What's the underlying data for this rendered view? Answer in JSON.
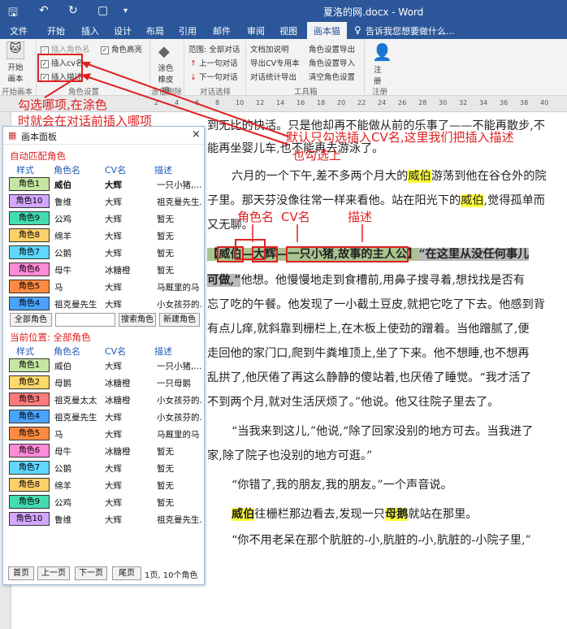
{
  "titlebar": {
    "title": "夏洛的网.docx - Word",
    "save_icon": "save-icon",
    "undo_icon": "undo-icon",
    "redo_icon": "redo-icon"
  },
  "tabs": [
    "文件",
    "开始",
    "插入",
    "设计",
    "布局",
    "引用",
    "邮件",
    "审阅",
    "视图",
    "画本猫"
  ],
  "tell_me": "告诉我您想要做什么...",
  "ribbon": {
    "start_label": "开始画本",
    "start_group": "开始画本",
    "cb_insert_role": "插入角色名",
    "cb_insert_cv": "插入cv名",
    "cb_insert_desc": "插入描述",
    "cb_highlight": "角色高亮",
    "group_roles": "角色设置",
    "eraser": "涂色橡皮擦",
    "group_erase": "涂色删除",
    "scope": "范围: 全部对话",
    "prev": "上一句对话",
    "next": "下一句对话",
    "group_dialog": "对话选择",
    "tool1": "文档加说明",
    "tool2": "导出CV专用本",
    "tool3": "对话统计导出",
    "tool4": "角色设置导出",
    "tool5": "角色设置导入",
    "tool6": "清空角色设置",
    "group_tools": "工具箱",
    "register": "注册",
    "group_register": "注册"
  },
  "panel": {
    "title": "画本面板",
    "section_auto": "自动匹配角色",
    "headers": [
      "样式",
      "角色名",
      "CV名",
      "描述"
    ],
    "auto_rows": [
      {
        "badge": "角色1",
        "color": "#c5e7a3",
        "name": "威伯",
        "cv": "大辉",
        "desc": "一只小猪,..."
      },
      {
        "badge": "角色10",
        "color": "#d3a6ff",
        "name": "鲁维",
        "cv": "大辉",
        "desc": "祖克曼先生..."
      },
      {
        "badge": "角色9",
        "color": "#43dcb0",
        "name": "公鸡",
        "cv": "大辉",
        "desc": "暂无"
      },
      {
        "badge": "角色8",
        "color": "#ffd06a",
        "name": "绵羊",
        "cv": "大辉",
        "desc": "暂无"
      },
      {
        "badge": "角色7",
        "color": "#5fd7ff",
        "name": "公鹅",
        "cv": "大辉",
        "desc": "暂无"
      },
      {
        "badge": "角色6",
        "color": "#ff8ad8",
        "name": "母牛",
        "cv": "冰糖橙",
        "desc": "暂无"
      },
      {
        "badge": "角色5",
        "color": "#ff8a40",
        "name": "马",
        "cv": "大辉",
        "desc": "马厩里的马"
      },
      {
        "badge": "角色4",
        "color": "#4aa3ff",
        "name": "祖克曼先生",
        "cv": "大辉",
        "desc": "小女孩芬的..."
      }
    ],
    "btn_all": "全部角色",
    "btn_search": "搜索角色",
    "btn_new": "新建角色",
    "section_current": "当前位置: 全部角色",
    "all_rows": [
      {
        "badge": "角色1",
        "color": "#c5e7a3",
        "name": "威伯",
        "cv": "大辉",
        "desc": "一只小猪,..."
      },
      {
        "badge": "角色2",
        "color": "#ffd96a",
        "name": "母鹅",
        "cv": "冰糖橙",
        "desc": "一只母鹅"
      },
      {
        "badge": "角色3",
        "color": "#ff7b7b",
        "name": "祖克曼太太",
        "cv": "冰糖橙",
        "desc": "小女孩芬的..."
      },
      {
        "badge": "角色4",
        "color": "#4aa3ff",
        "name": "祖克曼先生",
        "cv": "大辉",
        "desc": "小女孩芬的..."
      },
      {
        "badge": "角色5",
        "color": "#ff8a40",
        "name": "马",
        "cv": "大辉",
        "desc": "马厩里的马"
      },
      {
        "badge": "角色6",
        "color": "#ff8ad8",
        "name": "母牛",
        "cv": "冰糖橙",
        "desc": "暂无"
      },
      {
        "badge": "角色7",
        "color": "#5fd7ff",
        "name": "公鹅",
        "cv": "大辉",
        "desc": "暂无"
      },
      {
        "badge": "角色8",
        "color": "#ffd06a",
        "name": "绵羊",
        "cv": "大辉",
        "desc": "暂无"
      },
      {
        "badge": "角色9",
        "color": "#43dcb0",
        "name": "公鸡",
        "cv": "大辉",
        "desc": "暂无"
      },
      {
        "badge": "角色10",
        "color": "#d3a6ff",
        "name": "鲁维",
        "cv": "大辉",
        "desc": "祖克曼先生..."
      }
    ],
    "nav_first": "首页",
    "nav_prev": "上一页",
    "nav_next": "下一页",
    "nav_last": "尾页",
    "page_info": "1页, 10个角色"
  },
  "doc": {
    "p0": "到无比的快活。只是他却再不能做从前的乐事了——不能再散步,不",
    "p1": "能再坐婴儿车,也不能再去游泳了。",
    "p2a": "六月的一个下午,差不多两个月大的",
    "wilbur": "威伯",
    "p2b": "游荡到他在谷仓外的院",
    "p3a": "子里。那天芬没像往常一样来看他。站在阳光下的",
    "p3b": ",觉得孤单而",
    "p4": "又无聊。",
    "tag_open": "【",
    "tag_role": "威伯",
    "tag_cv": "大辉",
    "tag_desc": "一只小猪,故事的主人公",
    "tag_close": "】",
    "quote1": "“在这里从没任何事儿",
    "quote2": "可做,”",
    "p6b": "他想。他慢慢地走到食槽前,用鼻子搜寻着,想找找是否有",
    "p7": "忘了吃的午餐。他发现了一小截土豆皮,就把它吃了下去。他感到背",
    "p8": "有点儿痒,就斜靠到栅栏上,在木板上使劲的蹭着。当他蹭腻了,便",
    "p9": "走回他的家门口,爬到牛粪堆顶上,坐了下来。他不想睡,也不想再",
    "p10": "乱拱了,他厌倦了再这么静静的傻站着,也厌倦了睡觉。“我才活了",
    "p11": "不到两个月,就对生活厌烦了。”他说。他又往院子里去了。",
    "p12": "“当我来到这儿,”他说,“除了回家没别的地方可去。当我进了",
    "p13": "家,除了院子也没别的地方可逛。”",
    "p14": "“你错了,我的朋友,我的朋友。”一个声音说。",
    "p15b": "往栅栏那边看去,发现一只",
    "goose": "母鹅",
    "p15c": "就站在那里。",
    "p16": "“你不用老呆在那个肮脏的-小,肮脏的-小,肮脏的-小院子里,”"
  },
  "annotations": {
    "left1": "勾选哪项,在涂色",
    "left2": "时就会在对话前插入哪项",
    "right1": "默认只勾选插入CV名,这里我们把插入描述",
    "right2": "也勾选上",
    "lbl_role": "角色名",
    "lbl_cv": "CV名",
    "lbl_desc": "描述"
  },
  "ruler_marks": [
    "2",
    "4",
    "6",
    "8",
    "10",
    "12",
    "14",
    "16",
    "18",
    "20",
    "22",
    "24",
    "26",
    "28",
    "30",
    "32",
    "34",
    "36",
    "38",
    "40"
  ]
}
